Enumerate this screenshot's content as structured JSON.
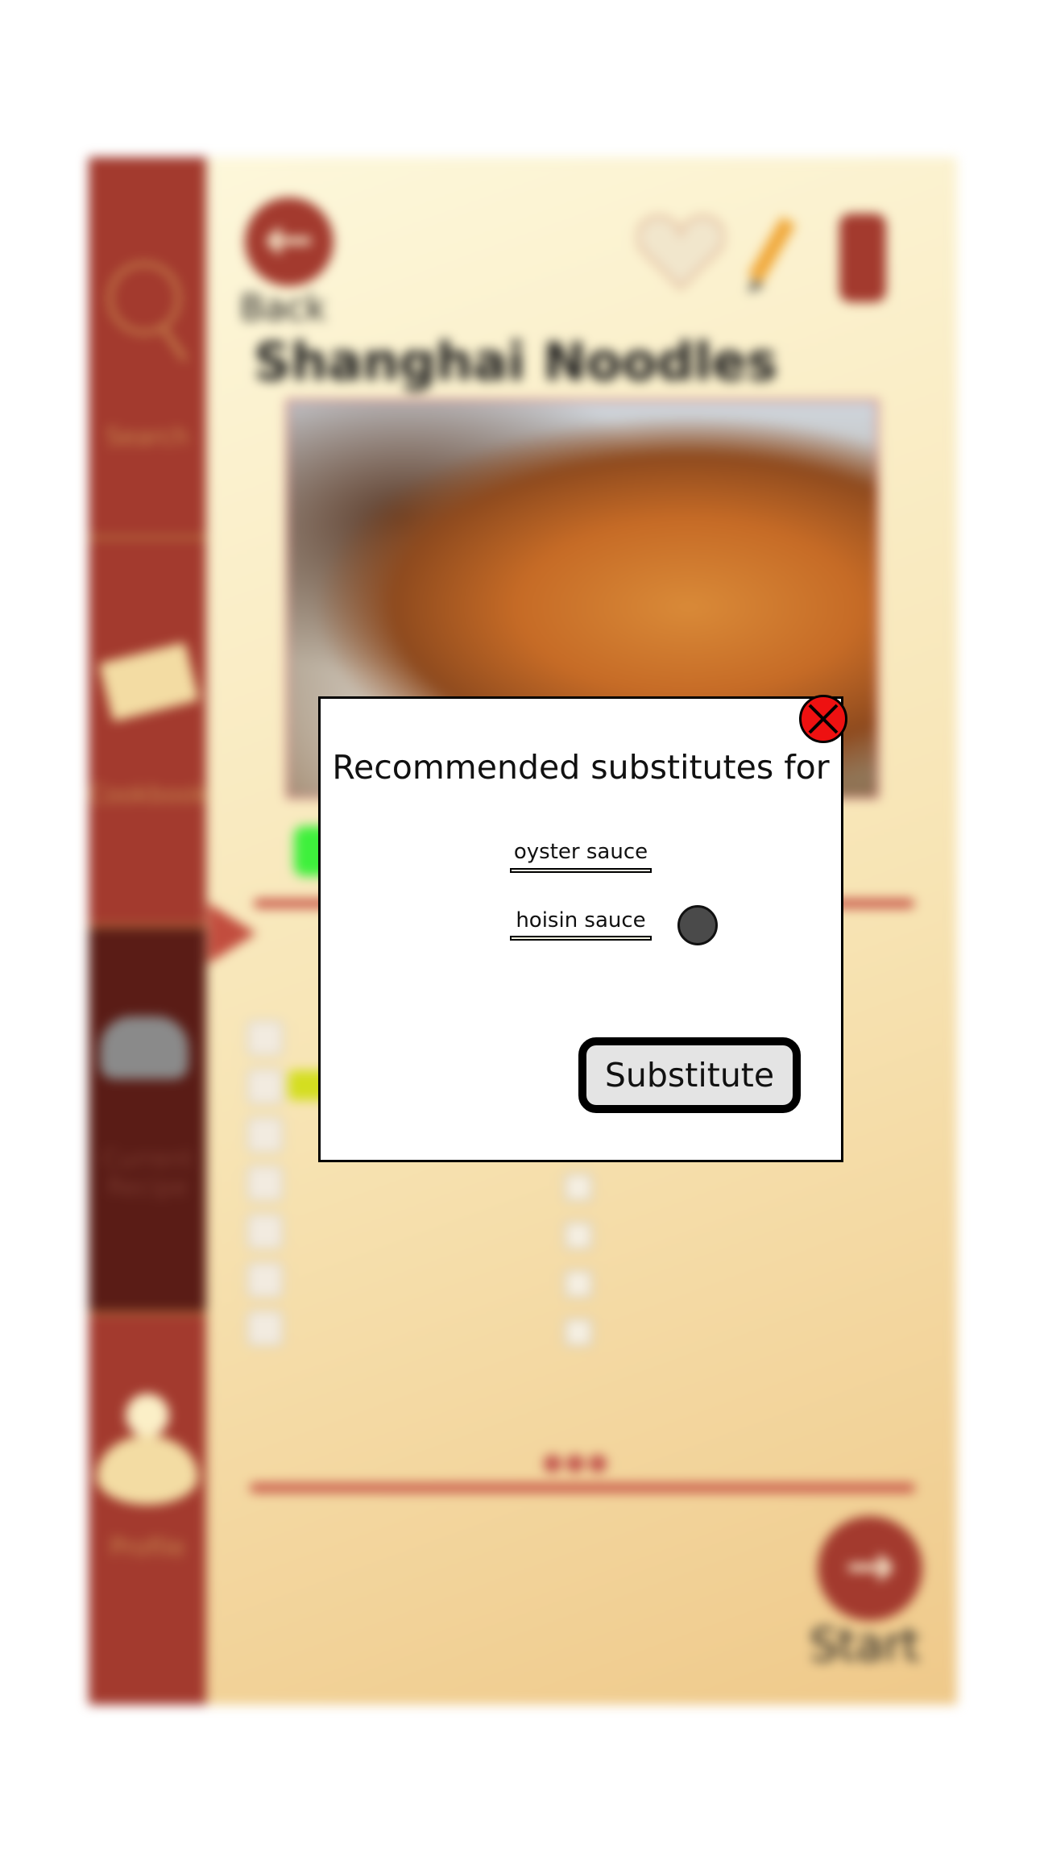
{
  "recipe": {
    "title": "Shanghai Noodles",
    "back_label": "Back",
    "start_label": "Start"
  },
  "sidebar": {
    "items": [
      {
        "label": "Search",
        "icon": "search-icon"
      },
      {
        "label": "Cookbook",
        "icon": "book-icon"
      },
      {
        "label": "Current Recipe",
        "icon": "chef-hat-icon",
        "active": true
      },
      {
        "label": "Profile",
        "icon": "profile-icon"
      }
    ]
  },
  "header_icons": [
    "heart-icon",
    "pencil-icon",
    "timer-icon"
  ],
  "modal": {
    "heading": "Recommended substitutes for",
    "original_ingredient": "oyster sauce",
    "substitute_option": "hoisin sauce",
    "action_label": "Substitute",
    "close_icon": "close-icon"
  },
  "colors": {
    "brand": "#a33a2e",
    "sidebar_active": "#5a1c16",
    "highlight": "#d4de20",
    "close": "#ee1111",
    "green_chip": "#3ef03c"
  }
}
